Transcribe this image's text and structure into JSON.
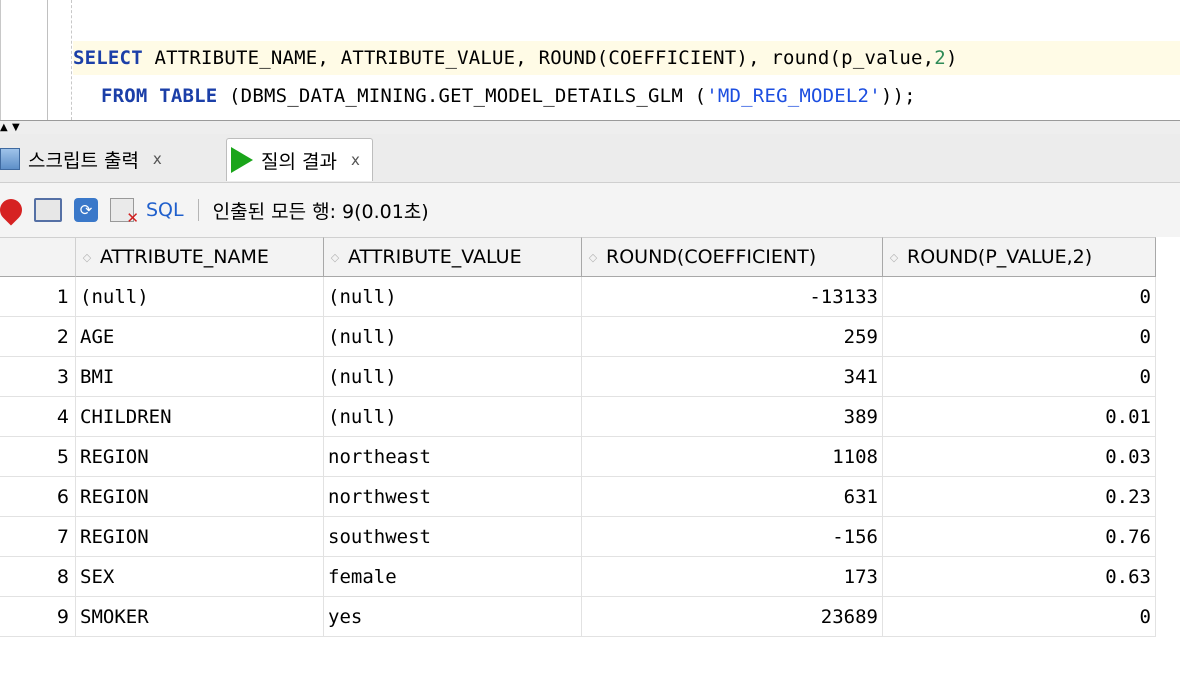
{
  "editor": {
    "line1": {
      "kw_select": "SELECT",
      "text_a": " ATTRIBUTE_NAME, ATTRIBUTE_VALUE, ROUND(COEFFICIENT), round(p_value,",
      "num": "2",
      "text_b": ")"
    },
    "line2": {
      "kw_from": "FROM",
      "space1": " ",
      "kw_table": "TABLE",
      "text_a": " (DBMS_DATA_MINING.GET_MODEL_DETAILS_GLM (",
      "str": "'MD_REG_MODEL2'",
      "text_b": "));"
    }
  },
  "tabs": {
    "script_output": {
      "label": "스크립트 출력",
      "close": "x"
    },
    "query_result": {
      "label": "질의 결과",
      "close": "x"
    }
  },
  "toolbar": {
    "sql_label": "SQL",
    "separator": "|",
    "status": "인출된 모든 행: 9(0.01초)"
  },
  "table": {
    "columns": [
      "ATTRIBUTE_NAME",
      "ATTRIBUTE_VALUE",
      "ROUND(COEFFICIENT)",
      "ROUND(P_VALUE,2)"
    ],
    "rows": [
      {
        "n": "1",
        "name": "(null)",
        "value": "(null)",
        "coef": "-13133",
        "p": "0"
      },
      {
        "n": "2",
        "name": "AGE",
        "value": "(null)",
        "coef": "259",
        "p": "0"
      },
      {
        "n": "3",
        "name": "BMI",
        "value": "(null)",
        "coef": "341",
        "p": "0"
      },
      {
        "n": "4",
        "name": "CHILDREN",
        "value": "(null)",
        "coef": "389",
        "p": "0.01"
      },
      {
        "n": "5",
        "name": "REGION",
        "value": "northeast",
        "coef": "1108",
        "p": "0.03"
      },
      {
        "n": "6",
        "name": "REGION",
        "value": "northwest",
        "coef": "631",
        "p": "0.23"
      },
      {
        "n": "7",
        "name": "REGION",
        "value": "southwest",
        "coef": "-156",
        "p": "0.76"
      },
      {
        "n": "8",
        "name": "SEX",
        "value": "female",
        "coef": "173",
        "p": "0.63"
      },
      {
        "n": "9",
        "name": "SMOKER",
        "value": "yes",
        "coef": "23689",
        "p": "0"
      }
    ]
  }
}
